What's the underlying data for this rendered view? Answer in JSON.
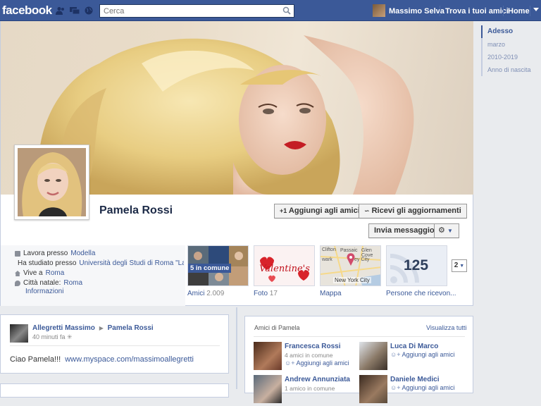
{
  "app": {
    "logo": "facebook"
  },
  "topbar": {
    "search_placeholder": "Cerca",
    "user_name": "Massimo Selva",
    "find_friends": "Trova i tuoi amici",
    "home": "Home"
  },
  "profile": {
    "name": "Pamela Rossi",
    "add_friend": "Aggiungi agli amici",
    "subscribe": "Ricevi gli aggiornamenti",
    "message": "Invia messaggio"
  },
  "about": {
    "work_prefix": "Lavora presso",
    "work_value": "Modella",
    "study_prefix": "Ha studiato presso",
    "study_value": "Università degli Studi di Roma \"La S...",
    "lives_prefix": "Vive a",
    "lives_value": "Roma",
    "hometown_prefix": "Città natale:",
    "hometown_value": "Roma",
    "info_link": "Informazioni"
  },
  "tiles": {
    "friends_badge": "5 in comune",
    "friends_label": "Amici",
    "friends_count": "2.009",
    "photos_label": "Foto",
    "photos_count": "17",
    "map_label": "Mappa",
    "subscribers_count": "125",
    "subscribers_label": "Persone che ricevon...",
    "more_count": "2",
    "map_city": "New York City",
    "map_places": [
      "Clifton",
      "Passaic",
      "Glen Cove",
      "wark",
      "ey City"
    ]
  },
  "scrubber": [
    "Adesso",
    "marzo",
    "2010-2019",
    "Anno di nascita"
  ],
  "post": {
    "author": "Allegretti Massimo",
    "target": "Pamela Rossi",
    "time": "40 minuti fa",
    "text": "Ciao Pamela!!!",
    "link": "www.myspace.com/massimoallegretti"
  },
  "friends_box": {
    "title": "Amici di Pamela",
    "view_all": "Visualizza tutti",
    "items": [
      {
        "name": "Francesca Rossi",
        "common": "4 amici in comune",
        "add": "Aggiungi agli amici"
      },
      {
        "name": "Luca Di Marco",
        "common": "",
        "add": "Aggiungi agli amici"
      },
      {
        "name": "Andrew Annunziata",
        "common": "1 amico in comune",
        "add": ""
      },
      {
        "name": "Daniele Medici",
        "common": "",
        "add": "Aggiungi agli amici"
      }
    ]
  },
  "colors": {
    "brand": "#3b5998",
    "topbar": "#3b5998",
    "page_bg": "#e9ebee"
  }
}
